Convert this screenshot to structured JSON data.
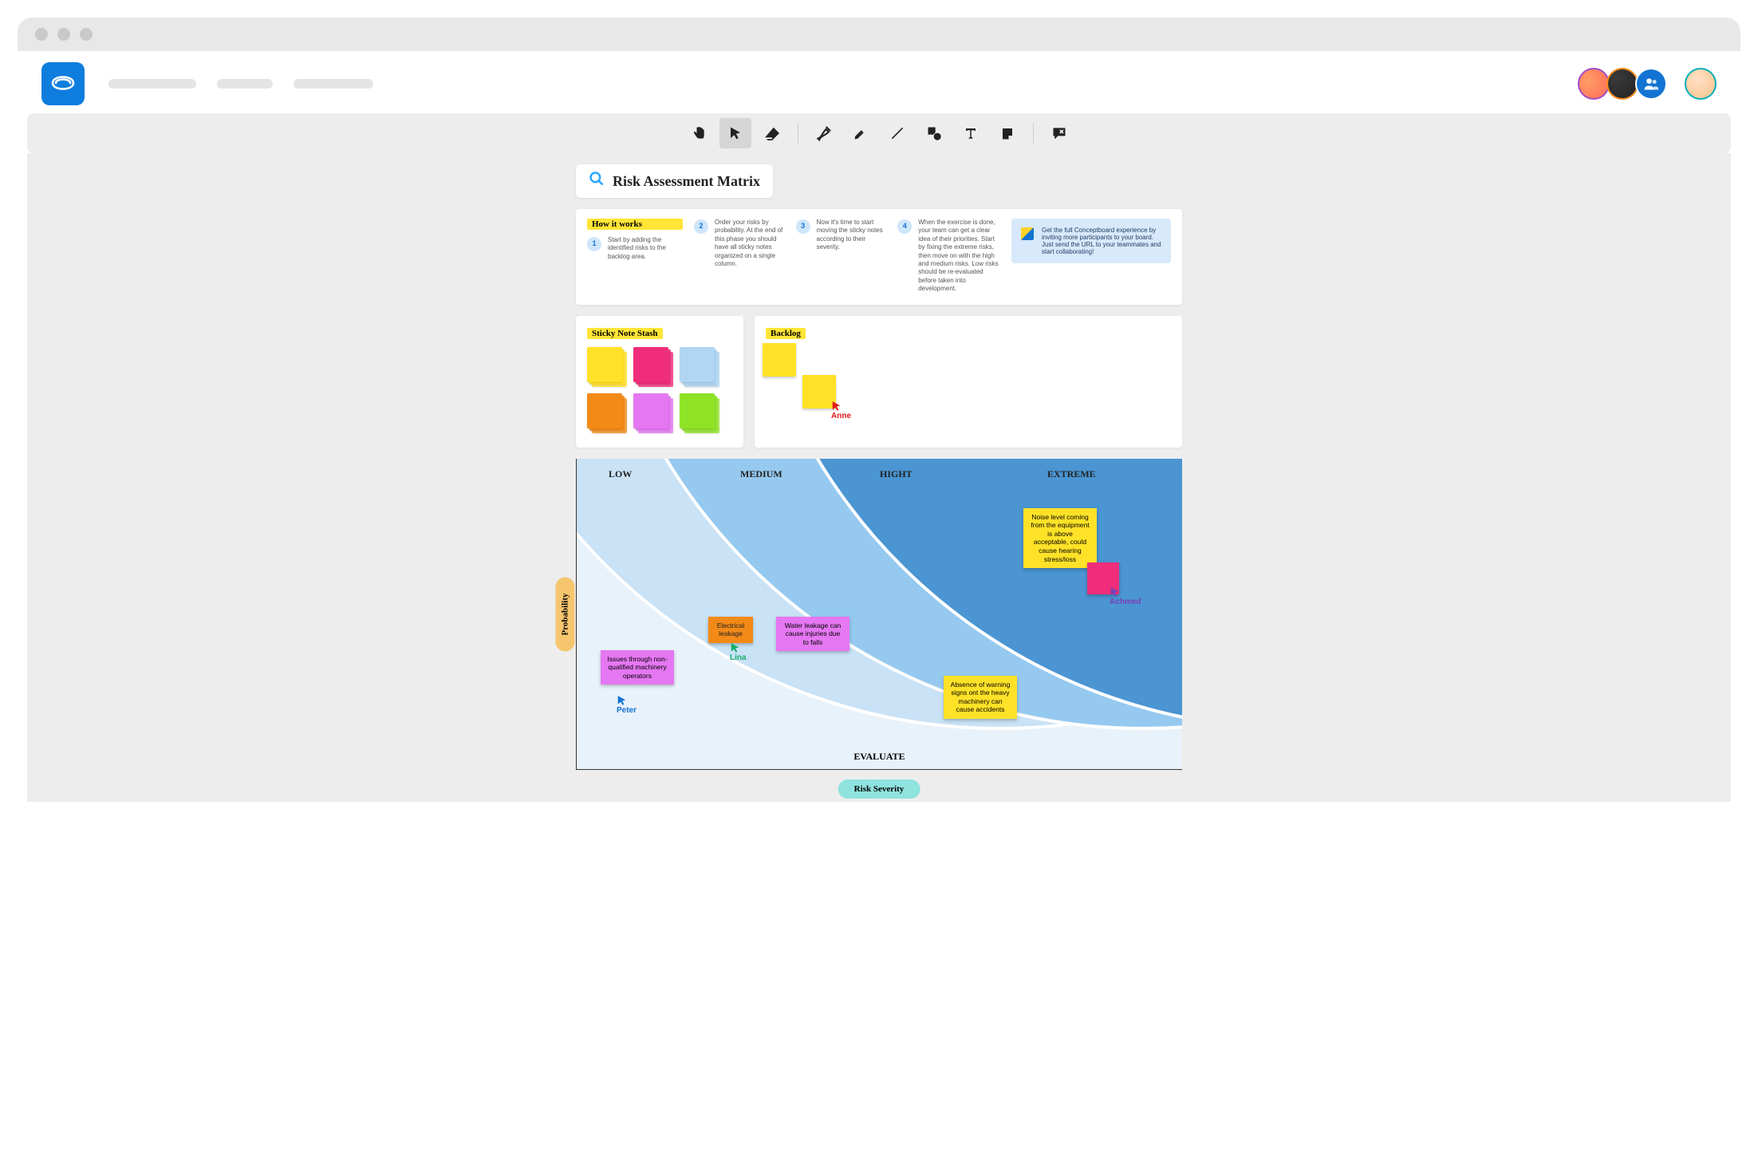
{
  "title": "Risk Assessment Matrix",
  "how_it_works": {
    "header": "How it works",
    "steps": [
      {
        "n": "1",
        "text": "Start by adding the identified risks to the backlog area."
      },
      {
        "n": "2",
        "text": "Order your risks by probability. At the end of this phase you should have all sticky notes organized on a single column."
      },
      {
        "n": "3",
        "text": "Now it's time to start moving the sticky notes according to their severity."
      },
      {
        "n": "4",
        "text": "When the exercise is done, your team can get a clear idea of their priorities. Start by fixing the extreme risks, then move on with the high and medium risks. Low risks should be re-evaluated before taken into development."
      }
    ],
    "cta": "Get the full Conceptboard experience by inviting more participants to your board. Just send the URL to your teammates and start collaborating!"
  },
  "stash_header": "Sticky Note Stash",
  "backlog_header": "Backlog",
  "collaborators": {
    "anne": "Anne",
    "peter": "Peter",
    "lina": "Lina",
    "achmed": "Achmed"
  },
  "axes": {
    "y": "Probability",
    "x": "Risk Severity"
  },
  "bands": {
    "low": "LOW",
    "medium": "MEDIUM",
    "high": "HIGHT",
    "extreme": "EXTREME",
    "evaluate": "EVALUATE"
  },
  "risks": {
    "issues": "Issues through non-qualified machinery operators",
    "electrical": "Electrical leakage",
    "water": "Water leakage can cause injuries due to falls",
    "absence": "Absence of warning signs ont the heavy machinery can cause accidents",
    "noise": "Noise level coming from the equipment is above acceptable, could cause hearing stress/loss"
  },
  "stash_colors": [
    "#ffe227",
    "#ef2d7a",
    "#b0d6f3",
    "#f38a17",
    "#e577f2",
    "#8fe327"
  ]
}
